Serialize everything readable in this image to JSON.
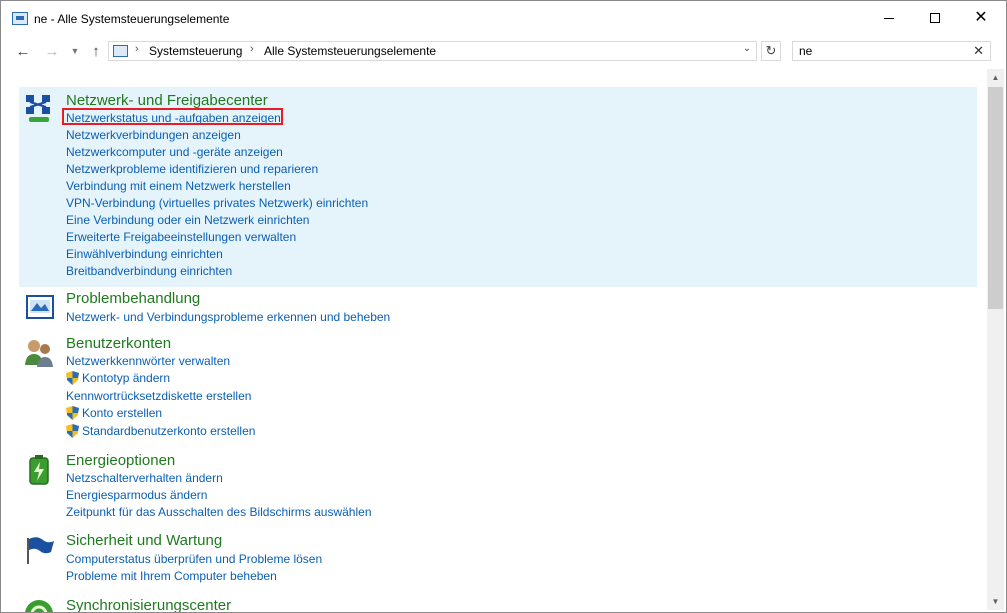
{
  "window": {
    "title": "ne - Alle Systemsteuerungselemente"
  },
  "address": {
    "crumbs": [
      "Systemsteuerung",
      "Alle Systemsteuerungselemente"
    ]
  },
  "search": {
    "value": "ne"
  },
  "categories": [
    {
      "title": "Netzwerk- und Freigabecenter",
      "links": [
        "Netzwerkstatus und -aufgaben anzeigen",
        "Netzwerkverbindungen anzeigen",
        "Netzwerkcomputer und -geräte anzeigen",
        "Netzwerkprobleme identifizieren und reparieren",
        "Verbindung mit einem Netzwerk herstellen",
        "VPN-Verbindung (virtuelles privates Netzwerk) einrichten",
        "Eine Verbindung oder ein Netzwerk einrichten",
        "Erweiterte Freigabeeinstellungen verwalten",
        "Einwählverbindung einrichten",
        "Breitbandverbindung einrichten"
      ]
    },
    {
      "title": "Problembehandlung",
      "links": [
        "Netzwerk- und Verbindungsprobleme erkennen und beheben"
      ]
    },
    {
      "title": "Benutzerkonten",
      "links": [
        "Netzwerkkennwörter verwalten",
        "Kontotyp ändern",
        "Kennwortrücksetzdiskette erstellen",
        "Konto erstellen",
        "Standardbenutzerkonto erstellen"
      ]
    },
    {
      "title": "Energieoptionen",
      "links": [
        "Netzschalterverhalten ändern",
        "Energiesparmodus ändern",
        "Zeitpunkt für das Ausschalten des Bildschirms auswählen"
      ]
    },
    {
      "title": "Sicherheit und Wartung",
      "links": [
        "Computerstatus überprüfen und Probleme lösen",
        "Probleme mit Ihrem Computer beheben"
      ]
    },
    {
      "title": "Synchronisierungscenter",
      "links": []
    }
  ],
  "colors": {
    "link": "#0a5fb4",
    "category_title": "#1f7a1f",
    "selection": "#e5f3fb",
    "highlight": "#e81c24"
  }
}
